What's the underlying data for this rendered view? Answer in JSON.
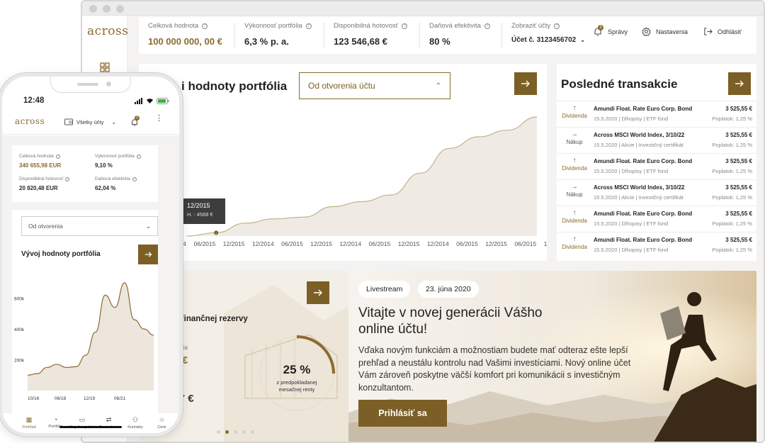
{
  "brand": {
    "logo": "across",
    "accent": "#7c5f26",
    "gold_text": "#8b6a2f"
  },
  "topbar": {
    "stats": [
      {
        "label": "Celková hodnota",
        "value": "100 000 000, 00 €"
      },
      {
        "label": "Výkonnosť portfólia",
        "value": "6,3 % p. a."
      },
      {
        "label": "Disponibilná hotovosť",
        "value": "123 546,68 €"
      },
      {
        "label": "Daňová efektivita",
        "value": "80 %"
      }
    ],
    "account": {
      "label": "Zobraziť účty",
      "value": "Účet č. 3123456702"
    },
    "nav": {
      "messages": "Správy",
      "messages_badge": "3",
      "settings": "Nastavenia",
      "logout": "Odhlásiť"
    }
  },
  "portfolio": {
    "title_fragment": "i hodnoty portfólia",
    "range": "Od otvorenia účtu",
    "tooltip": {
      "date": "12/2015",
      "value": "H. : 4568 €"
    },
    "chart_data": {
      "type": "area",
      "x": [
        "06/2015",
        "12/2015",
        "12/2014",
        "06/2015",
        "12/2015",
        "12/2014",
        "06/2015",
        "12/2015",
        "12/2014",
        "06/2015",
        "12/2015",
        "06/2015",
        "12/2015"
      ],
      "x_fragment": "14",
      "values": [
        0,
        1000,
        3900,
        5200,
        5700,
        8900,
        10400,
        12400,
        19000,
        26500,
        30000,
        32000,
        36000
      ],
      "highlight_index": 1,
      "grid": false
    }
  },
  "transactions": {
    "title": "Posledné transakcie",
    "rows": [
      {
        "type": "Dividenda",
        "kind": "dividend",
        "name": "Amundi Float. Rate Euro Corp. Bond",
        "amount": "3 525,55 €",
        "detail": "15.5.2020 | Dlhopisy | ETF fond",
        "fee": "Poplatok: 1,25 %"
      },
      {
        "type": "Nákup",
        "kind": "buy",
        "name": "Across MSCI World Index, 3/10/22",
        "amount": "3 525,55 €",
        "detail": "15.5.2020 | Akcie | Investičný certifikát",
        "fee": "Poplatok: 1,25 %"
      },
      {
        "type": "Dividenda",
        "kind": "dividend",
        "name": "Amundi Float. Rate Euro Corp. Bond",
        "amount": "3 525,55 €",
        "detail": "15.5.2020 | Dlhopisy | ETF fond",
        "fee": "Poplatok: 1,25 %"
      },
      {
        "type": "Nákup",
        "kind": "buy",
        "name": "Across MSCI World Index, 3/10/22",
        "amount": "3 525,55 €",
        "detail": "15.5.2020 | Akcie | Investičný certifikát",
        "fee": "Poplatok: 1,25 %"
      },
      {
        "type": "Dividenda",
        "kind": "dividend",
        "name": "Amundi Float. Rate Euro Corp. Bond",
        "amount": "3 525,55 €",
        "detail": "15.5.2020 | Dlhopisy | ETF fond",
        "fee": "Poplatok: 1,25 %"
      },
      {
        "type": "Dividenda",
        "kind": "dividend",
        "name": "Amundi Float. Rate Euro Corp. Bond",
        "amount": "3 525,55 €",
        "detail": "15.5.2020 | Dlhopisy | ETF fond",
        "fee": "Poplatok: 1,25 %"
      }
    ]
  },
  "reserve": {
    "title_fragment": "nie finančnej rezervy",
    "label_fragment": "hodnota",
    "value1_fragment": "54 €",
    "label2_fragment": "a",
    "value2_fragment": "217 €",
    "percent": "25 %",
    "percent_caption": "z predpokladanej mesačnej renty",
    "progress": 0.25,
    "pager_active": 1,
    "pager_count": 5
  },
  "hero": {
    "chip_live": "Livestream",
    "chip_date": "23. júna 2020",
    "title": "Vitajte v novej generácii Vášho online účtu!",
    "text": "Vďaka novým funkciám a možnostiam budete mať odteraz ešte lepší prehľad a neustálu kontrolu nad Vašimi investíciami. Nový online účet Vám zároveň poskytne väčší komfort pri komunikácii s investičným konzultantom.",
    "button": "Prihlásiť sa"
  },
  "phone": {
    "time": "12:48",
    "accounts": "Všetky účty",
    "badge": "3",
    "stats": [
      {
        "label": "Celková hodnota",
        "value": "340 655,98 EUR"
      },
      {
        "label": "Výkonnosť portfólia",
        "value": "9,10 %"
      },
      {
        "label": "Disponibilná hotovosť",
        "value": "20 820,48 EUR"
      },
      {
        "label": "Daňová efektivita",
        "value": "62,04 %"
      }
    ],
    "range": "Od otvorenia",
    "chart_title": "Vývoj hodnoty portfólia",
    "chart_data": {
      "type": "area",
      "y_ticks": [
        "600k",
        "400k",
        "200k"
      ],
      "y_tick_values": [
        600000,
        400000,
        200000
      ],
      "x_ticks": [
        "10/16",
        "06/18",
        "12/19",
        "06/21"
      ],
      "values": [
        100000,
        110000,
        150000,
        170000,
        150000,
        155000,
        230000,
        380000,
        620000,
        540000,
        700000,
        460000,
        400000,
        360000
      ],
      "ylim": [
        0,
        700000
      ]
    },
    "tabs": [
      {
        "label": "Prehľad",
        "icon": "grid-icon"
      },
      {
        "label": "Portfólio",
        "icon": "pie-icon"
      },
      {
        "label": "Majetkový účet",
        "icon": "wallet-icon"
      },
      {
        "label": "Transakcie",
        "icon": "swap-icon"
      },
      {
        "label": "Kontakty",
        "icon": "contacts-icon"
      },
      {
        "label": "Ciele",
        "icon": "star-icon"
      }
    ]
  }
}
